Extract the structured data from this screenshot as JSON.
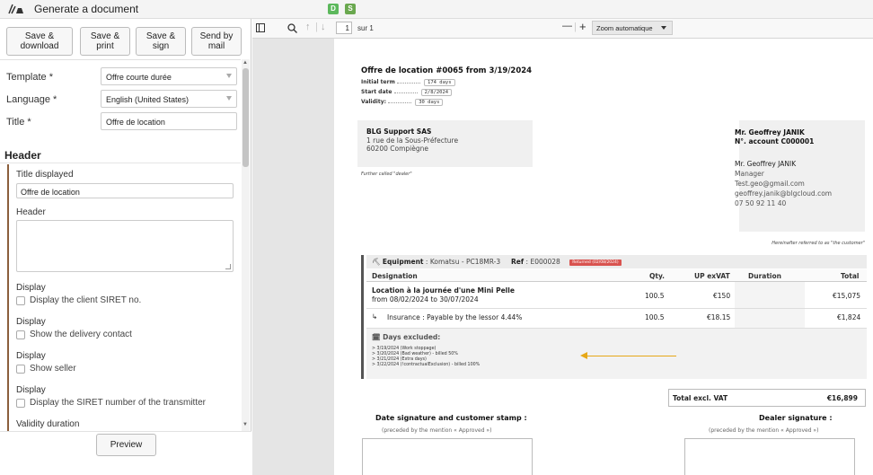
{
  "app": {
    "title": "Generate a document",
    "badges": [
      "D",
      "S"
    ],
    "colors": {
      "badge_d": "#5cb85c",
      "badge_s": "#6aa84f",
      "accent_bar": "#8b5e3c",
      "returned": "#d9534f",
      "arrow": "#e6a817"
    }
  },
  "actions": [
    {
      "line1": "Save &",
      "line2": "download"
    },
    {
      "line1": "Save &",
      "line2": "print"
    },
    {
      "line1": "Save &",
      "line2": "sign"
    },
    {
      "line1": "Send by",
      "line2": "mail"
    }
  ],
  "form": {
    "template_label": "Template *",
    "template_value": "Offre courte durée",
    "language_label": "Language *",
    "language_value": "English (United States)",
    "title_label": "Title *",
    "title_value": "Offre de location",
    "section_header": "Header",
    "title_displayed_label": "Title displayed",
    "title_displayed_value": "Offre de location",
    "header_label": "Header",
    "display_items": [
      {
        "group": "Display",
        "label": "Display the client SIRET no."
      },
      {
        "group": "Display",
        "label": "Show the delivery contact"
      },
      {
        "group": "Display",
        "label": "Show seller"
      },
      {
        "group": "Display",
        "label": "Display the SIRET number of the transmitter"
      }
    ],
    "validity_label": "Validity duration",
    "preview_label": "Preview"
  },
  "viewer": {
    "page_number": "1",
    "page_count": "sur 1",
    "zoom": "Zoom automatique",
    "zoom_minus": "—",
    "zoom_plus": "+"
  },
  "doc": {
    "title": "Offre de location #0065 from 3/19/2024",
    "meta": [
      {
        "label": "Initial term",
        "value": "174 days"
      },
      {
        "label": "Start date",
        "value": "2/8/2024"
      },
      {
        "label": "Validity:",
        "value": "30 days"
      }
    ],
    "dealer": {
      "name": "BLG Support SAS",
      "address1": "1 rue de la Sous-Préfecture",
      "address2": "60200 Compiègne",
      "further": "Further called \"dealer\""
    },
    "customer": {
      "name": "Mr. Geoffrey JANIK",
      "account": "N°. account C000001",
      "contact": "Mr. Geoffrey JANIK",
      "role": "Manager",
      "email1": "Test.geo@gmail.com",
      "email2": "geoffrey.janik@blgcloud.com",
      "phone": "07 50 92 11 40",
      "hereinafter": "Hereinafter referred to as \"the customer\""
    },
    "equipment": {
      "label": "Equipment",
      "value": "Komatsu - PC18MR-3",
      "ref_label": "Ref",
      "ref_value": "E000028",
      "status": "Returned (02/08/2024)"
    },
    "columns": [
      "Designation",
      "Qty.",
      "UP exVAT",
      "Duration",
      "Total"
    ],
    "rows": [
      {
        "designation": "Location à la journée d'une Mini Pelle",
        "sub": "from 08/02/2024 to 30/07/2024",
        "qty": "100.5",
        "up": "€150",
        "duration": "",
        "total": "€15,075"
      },
      {
        "designation": "Insurance : Payable by the lessor 4.44%",
        "sub": "",
        "qty": "100.5",
        "up": "€18.15",
        "duration": "",
        "total": "€1,824"
      }
    ],
    "excluded_title": "Days excluded:",
    "excluded": [
      "> 3/19/2024 (Work stoppage)",
      "> 3/20/2024 (Bad weather) - billed 50%",
      "> 3/21/2024 (Extra days)",
      "> 3/22/2024 (!contractualExclusion) - billed 100%"
    ],
    "total_label": "Total excl. VAT",
    "total_value": "€16,899",
    "sig_customer_title": "Date signature and customer stamp :",
    "sig_customer_sub": "(preceded by the mention « Approved »)",
    "sig_dealer_title": "Dealer signature :",
    "sig_dealer_sub": "(preceded by the mention « Approved »)"
  }
}
